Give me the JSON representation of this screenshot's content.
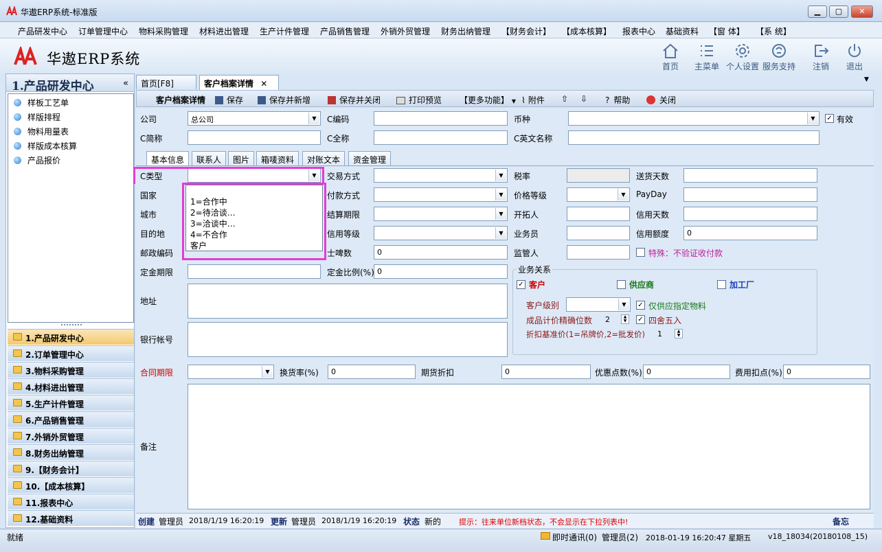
{
  "window": {
    "title": "华遨ERP系统-标准版",
    "min": "▁",
    "max": "▢",
    "close": "✕"
  },
  "menu": [
    "产品研发中心",
    "订单管理中心",
    "物料采购管理",
    "材料进出管理",
    "生产计件管理",
    "产品销售管理",
    "外销外贸管理",
    "财务出纳管理",
    "【财务会计】",
    "【成本核算】",
    "报表中心",
    "基础资料",
    "【窗 体】",
    "【系 统】"
  ],
  "header": {
    "brand": "华遨ERP系统",
    "buttons": [
      {
        "label": "首页",
        "icon": "home-icon"
      },
      {
        "label": "主菜单",
        "icon": "menu-list-icon"
      },
      {
        "label": "个人设置",
        "icon": "gear-icon"
      },
      {
        "label": "服务支持",
        "icon": "support-icon"
      },
      {
        "label": "注销",
        "icon": "logout-icon"
      },
      {
        "label": "退出",
        "icon": "power-icon"
      }
    ]
  },
  "sidebar": {
    "title": "1.产品研发中心",
    "collapse": "«",
    "tree": [
      "样板工艺单",
      "样版排程",
      "物料用量表",
      "样版成本核算",
      "产品报价"
    ],
    "nav": [
      "1.产品研发中心",
      "2.订单管理中心",
      "3.物料采购管理",
      "4.材料进出管理",
      "5.生产计件管理",
      "6.产品销售管理",
      "7.外销外贸管理",
      "8.财务出纳管理",
      "9.【财务会计】",
      "10.【成本核算】",
      "11.报表中心",
      "12.基础资料"
    ]
  },
  "tabs": {
    "home": "首页[F8]",
    "active": "客户档案详情",
    "close": "✕"
  },
  "toolbar": {
    "title": "客户档案详情",
    "save": "保存",
    "save_new": "保存并新增",
    "save_close": "保存并关闭",
    "print": "打印预览",
    "more": "【更多功能】",
    "attach": "附件",
    "help": "帮助",
    "close": "关闭"
  },
  "form": {
    "company_label": "公司",
    "company_value": "总公司",
    "code_label": "C编码",
    "currency_label": "币种",
    "valid_label": "有效",
    "short_label": "C简称",
    "full_label": "C全称",
    "en_label": "C英文名称",
    "subtabs": [
      "基本信息",
      "联系人",
      "图片",
      "箱唛资料",
      "对账文本",
      "资金管理"
    ],
    "type_label": "C类型",
    "trade_label": "交易方式",
    "tax_label": "税率",
    "delivery_label": "送货天数",
    "country_label": "国家",
    "pay_label": "付款方式",
    "price_level_label": "价格等级",
    "payday_label": "PayDay",
    "city_label": "城市",
    "settle_label": "结算期限",
    "developer_label": "开拓人",
    "credit_days_label": "信用天数",
    "dest_label": "目的地",
    "credit_level_label": "信用等级",
    "sales_label": "业务员",
    "credit_limit_label": "信用额度",
    "credit_limit_value": "0",
    "zip_label": "邮政编码",
    "tariff_label": "士啤数",
    "tariff_value": "0",
    "supervisor_label": "监管人",
    "special_label": "特殊：不验证收付款",
    "deposit_label": "定金期限",
    "deposit_ratio_label": "定金比例(%)",
    "deposit_ratio_value": "0",
    "address_label": "地址",
    "bank_label": "银行帐号",
    "biz_group": "业务关系",
    "biz_customer": "客户",
    "biz_supplier": "供应商",
    "biz_factory": "加工厂",
    "cust_level_label": "客户级别",
    "only_supply_label": "仅供应指定物料",
    "precision_label": "成品计价精确位数",
    "precision_value": "2",
    "round_label": "四舍五入",
    "discount_base_label": "折扣基准价(1=吊牌价,2=批发价)",
    "discount_base_value": "1",
    "contract_label": "合同期限",
    "exchange_label": "换货率(%)",
    "exchange_value": "0",
    "futures_label": "期货折扣",
    "futures_value": "0",
    "bonus_label": "优惠点数(%)",
    "bonus_value": "0",
    "fee_label": "费用扣点(%)",
    "fee_value": "0",
    "remark_label": "备注"
  },
  "dropdown": [
    "1=合作中",
    "2=待洽谈…",
    "3=洽谈中…",
    "4=不合作",
    "客户"
  ],
  "record": {
    "create_label": "创建",
    "create_user": "管理员",
    "create_time": "2018/1/19 16:20:19",
    "update_label": "更新",
    "update_user": "管理员",
    "update_time": "2018/1/19 16:20:19",
    "state_label": "状态",
    "state_value": "新的",
    "tip": "提示：往来单位新档状态，不会显示在下拉列表中!",
    "memo": "备忘"
  },
  "status": {
    "ready": "就绪",
    "im": "即时通讯(0)",
    "user": "管理员(2)",
    "datetime": "2018-01-19  16:20:47 星期五",
    "version": "v18_18034(20180108_15)"
  }
}
